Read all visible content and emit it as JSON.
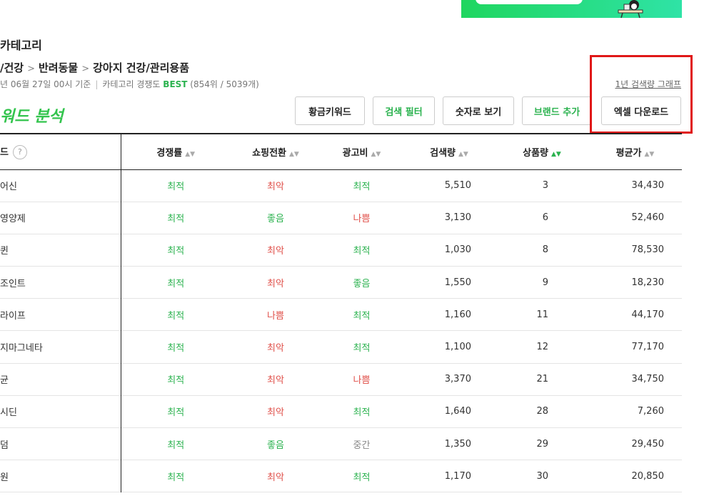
{
  "page": {
    "category_title": "카테고리",
    "breadcrumb": [
      "/건강",
      "반려동물",
      "강아지 건강/관리용품"
    ],
    "breadcrumb_sep": ">",
    "meta_date": "년 06월 27일 00시 기준",
    "meta_sep": "|",
    "meta_comp_label": "카테고리 경쟁도",
    "meta_comp_value": "BEST",
    "meta_rank": "(854위 / 5039개)",
    "graph_link": "1년 검색량 그래프",
    "analysis_title": "워드 분석"
  },
  "toolbar": {
    "golden_keyword": "황금키워드",
    "search_filter": "검색 필터",
    "number_view": "숫자로 보기",
    "add_brand": "브랜드 추가",
    "excel_download": "엑셀 다운로드"
  },
  "table": {
    "headers": {
      "keyword": "드",
      "help": "?",
      "competition": "경쟁률",
      "conversion": "쇼핑전환",
      "ad_cost": "광고비",
      "search_volume": "검색량",
      "product_count": "상품량",
      "avg_price": "평균가",
      "sort_arrow": "▲▼"
    },
    "rows": [
      {
        "keyword": "어신",
        "competition": "최적",
        "conversion": "최악",
        "ad_cost": "최적",
        "search_volume": "5,510",
        "product_count": "3",
        "avg_price": "34,430"
      },
      {
        "keyword": "영양제",
        "competition": "최적",
        "conversion": "좋음",
        "ad_cost": "나쁨",
        "search_volume": "3,130",
        "product_count": "6",
        "avg_price": "52,460"
      },
      {
        "keyword": "퀸",
        "competition": "최적",
        "conversion": "최악",
        "ad_cost": "최적",
        "search_volume": "1,030",
        "product_count": "8",
        "avg_price": "78,530"
      },
      {
        "keyword": "조인트",
        "competition": "최적",
        "conversion": "최악",
        "ad_cost": "좋음",
        "search_volume": "1,550",
        "product_count": "9",
        "avg_price": "18,230"
      },
      {
        "keyword": "라이프",
        "competition": "최적",
        "conversion": "나쁨",
        "ad_cost": "최적",
        "search_volume": "1,160",
        "product_count": "11",
        "avg_price": "44,170"
      },
      {
        "keyword": "지마그네타",
        "competition": "최적",
        "conversion": "최악",
        "ad_cost": "최적",
        "search_volume": "1,100",
        "product_count": "12",
        "avg_price": "77,170"
      },
      {
        "keyword": "균",
        "competition": "최적",
        "conversion": "최악",
        "ad_cost": "나쁨",
        "search_volume": "3,370",
        "product_count": "21",
        "avg_price": "34,750"
      },
      {
        "keyword": "시딘",
        "competition": "최적",
        "conversion": "최악",
        "ad_cost": "최적",
        "search_volume": "1,640",
        "product_count": "28",
        "avg_price": "7,260"
      },
      {
        "keyword": "덤",
        "competition": "최적",
        "conversion": "좋음",
        "ad_cost": "중간",
        "search_volume": "1,350",
        "product_count": "29",
        "avg_price": "29,450"
      },
      {
        "keyword": "원",
        "competition": "최적",
        "conversion": "최악",
        "ad_cost": "최적",
        "search_volume": "1,170",
        "product_count": "30",
        "avg_price": "20,850"
      }
    ]
  },
  "colors": {
    "good": "#2ab24e",
    "bad": "#e0504a",
    "mid": "#888888",
    "highlight": "#e01818",
    "banner": "#1fd65f"
  }
}
